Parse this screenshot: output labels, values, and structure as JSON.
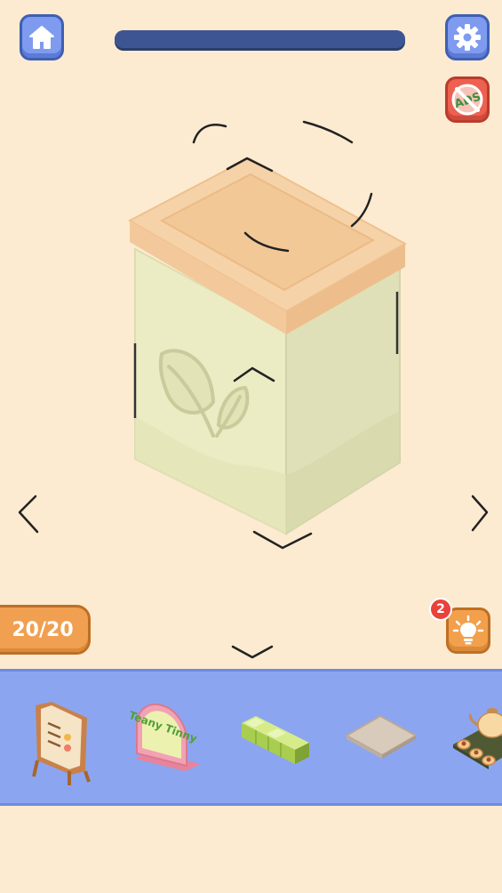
{
  "header": {
    "progress_fraction": 1.0,
    "home_icon": "home-icon",
    "settings_icon": "gear-icon",
    "no_ads_icon": "no-ads-icon",
    "no_ads_label": "ADS"
  },
  "scene": {
    "object": "tea-tin-jar",
    "nav_left_icon": "chevron-left-icon",
    "nav_right_icon": "chevron-right-icon",
    "nav_down_icon": "chevron-down-icon"
  },
  "counter": {
    "label": "20/20"
  },
  "hint": {
    "count": "2",
    "icon": "lightbulb-icon"
  },
  "tray": {
    "items": [
      {
        "name": "menu-board"
      },
      {
        "name": "teany-tinny-sign",
        "text": "Teany Tinny"
      },
      {
        "name": "green-block"
      },
      {
        "name": "floor-tile"
      },
      {
        "name": "tea-set-tray"
      }
    ]
  },
  "colors": {
    "background": "#FCEBD0",
    "accent_blue": "#7E9BEF",
    "tray_blue": "#8CA5F0",
    "progress_bar": "#3D5693",
    "orange": "#F2A04C",
    "red": "#EE6050"
  }
}
